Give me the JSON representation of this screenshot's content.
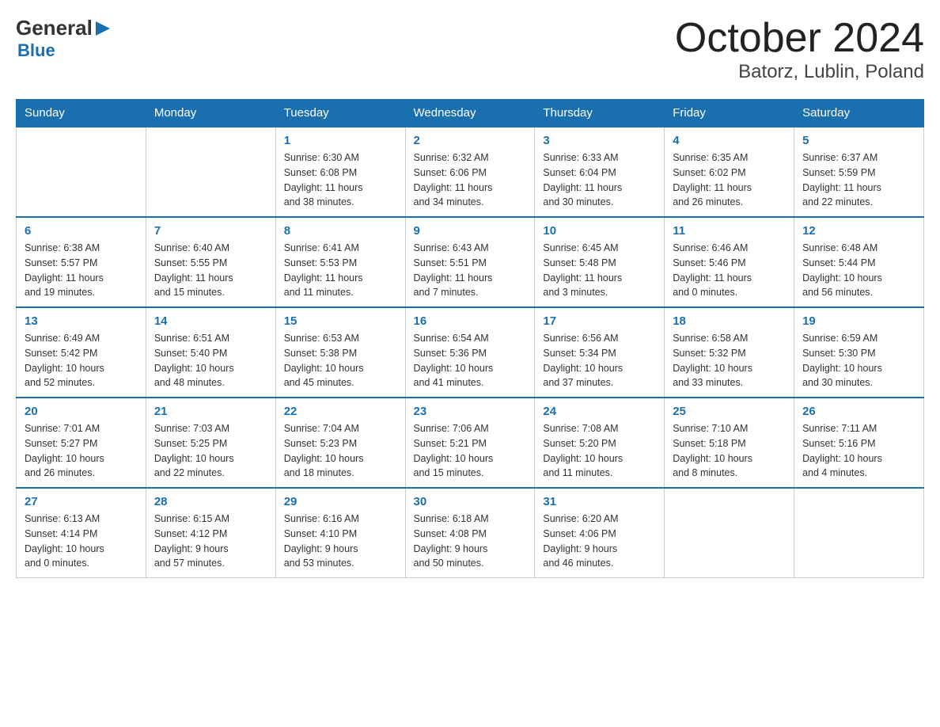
{
  "header": {
    "logo": {
      "general": "General",
      "arrow": "▶",
      "blue": "Blue"
    },
    "title": "October 2024",
    "subtitle": "Batorz, Lublin, Poland"
  },
  "calendar": {
    "weekdays": [
      "Sunday",
      "Monday",
      "Tuesday",
      "Wednesday",
      "Thursday",
      "Friday",
      "Saturday"
    ],
    "weeks": [
      [
        {
          "day": "",
          "info": ""
        },
        {
          "day": "",
          "info": ""
        },
        {
          "day": "1",
          "info": "Sunrise: 6:30 AM\nSunset: 6:08 PM\nDaylight: 11 hours\nand 38 minutes."
        },
        {
          "day": "2",
          "info": "Sunrise: 6:32 AM\nSunset: 6:06 PM\nDaylight: 11 hours\nand 34 minutes."
        },
        {
          "day": "3",
          "info": "Sunrise: 6:33 AM\nSunset: 6:04 PM\nDaylight: 11 hours\nand 30 minutes."
        },
        {
          "day": "4",
          "info": "Sunrise: 6:35 AM\nSunset: 6:02 PM\nDaylight: 11 hours\nand 26 minutes."
        },
        {
          "day": "5",
          "info": "Sunrise: 6:37 AM\nSunset: 5:59 PM\nDaylight: 11 hours\nand 22 minutes."
        }
      ],
      [
        {
          "day": "6",
          "info": "Sunrise: 6:38 AM\nSunset: 5:57 PM\nDaylight: 11 hours\nand 19 minutes."
        },
        {
          "day": "7",
          "info": "Sunrise: 6:40 AM\nSunset: 5:55 PM\nDaylight: 11 hours\nand 15 minutes."
        },
        {
          "day": "8",
          "info": "Sunrise: 6:41 AM\nSunset: 5:53 PM\nDaylight: 11 hours\nand 11 minutes."
        },
        {
          "day": "9",
          "info": "Sunrise: 6:43 AM\nSunset: 5:51 PM\nDaylight: 11 hours\nand 7 minutes."
        },
        {
          "day": "10",
          "info": "Sunrise: 6:45 AM\nSunset: 5:48 PM\nDaylight: 11 hours\nand 3 minutes."
        },
        {
          "day": "11",
          "info": "Sunrise: 6:46 AM\nSunset: 5:46 PM\nDaylight: 11 hours\nand 0 minutes."
        },
        {
          "day": "12",
          "info": "Sunrise: 6:48 AM\nSunset: 5:44 PM\nDaylight: 10 hours\nand 56 minutes."
        }
      ],
      [
        {
          "day": "13",
          "info": "Sunrise: 6:49 AM\nSunset: 5:42 PM\nDaylight: 10 hours\nand 52 minutes."
        },
        {
          "day": "14",
          "info": "Sunrise: 6:51 AM\nSunset: 5:40 PM\nDaylight: 10 hours\nand 48 minutes."
        },
        {
          "day": "15",
          "info": "Sunrise: 6:53 AM\nSunset: 5:38 PM\nDaylight: 10 hours\nand 45 minutes."
        },
        {
          "day": "16",
          "info": "Sunrise: 6:54 AM\nSunset: 5:36 PM\nDaylight: 10 hours\nand 41 minutes."
        },
        {
          "day": "17",
          "info": "Sunrise: 6:56 AM\nSunset: 5:34 PM\nDaylight: 10 hours\nand 37 minutes."
        },
        {
          "day": "18",
          "info": "Sunrise: 6:58 AM\nSunset: 5:32 PM\nDaylight: 10 hours\nand 33 minutes."
        },
        {
          "day": "19",
          "info": "Sunrise: 6:59 AM\nSunset: 5:30 PM\nDaylight: 10 hours\nand 30 minutes."
        }
      ],
      [
        {
          "day": "20",
          "info": "Sunrise: 7:01 AM\nSunset: 5:27 PM\nDaylight: 10 hours\nand 26 minutes."
        },
        {
          "day": "21",
          "info": "Sunrise: 7:03 AM\nSunset: 5:25 PM\nDaylight: 10 hours\nand 22 minutes."
        },
        {
          "day": "22",
          "info": "Sunrise: 7:04 AM\nSunset: 5:23 PM\nDaylight: 10 hours\nand 18 minutes."
        },
        {
          "day": "23",
          "info": "Sunrise: 7:06 AM\nSunset: 5:21 PM\nDaylight: 10 hours\nand 15 minutes."
        },
        {
          "day": "24",
          "info": "Sunrise: 7:08 AM\nSunset: 5:20 PM\nDaylight: 10 hours\nand 11 minutes."
        },
        {
          "day": "25",
          "info": "Sunrise: 7:10 AM\nSunset: 5:18 PM\nDaylight: 10 hours\nand 8 minutes."
        },
        {
          "day": "26",
          "info": "Sunrise: 7:11 AM\nSunset: 5:16 PM\nDaylight: 10 hours\nand 4 minutes."
        }
      ],
      [
        {
          "day": "27",
          "info": "Sunrise: 6:13 AM\nSunset: 4:14 PM\nDaylight: 10 hours\nand 0 minutes."
        },
        {
          "day": "28",
          "info": "Sunrise: 6:15 AM\nSunset: 4:12 PM\nDaylight: 9 hours\nand 57 minutes."
        },
        {
          "day": "29",
          "info": "Sunrise: 6:16 AM\nSunset: 4:10 PM\nDaylight: 9 hours\nand 53 minutes."
        },
        {
          "day": "30",
          "info": "Sunrise: 6:18 AM\nSunset: 4:08 PM\nDaylight: 9 hours\nand 50 minutes."
        },
        {
          "day": "31",
          "info": "Sunrise: 6:20 AM\nSunset: 4:06 PM\nDaylight: 9 hours\nand 46 minutes."
        },
        {
          "day": "",
          "info": ""
        },
        {
          "day": "",
          "info": ""
        }
      ]
    ]
  }
}
